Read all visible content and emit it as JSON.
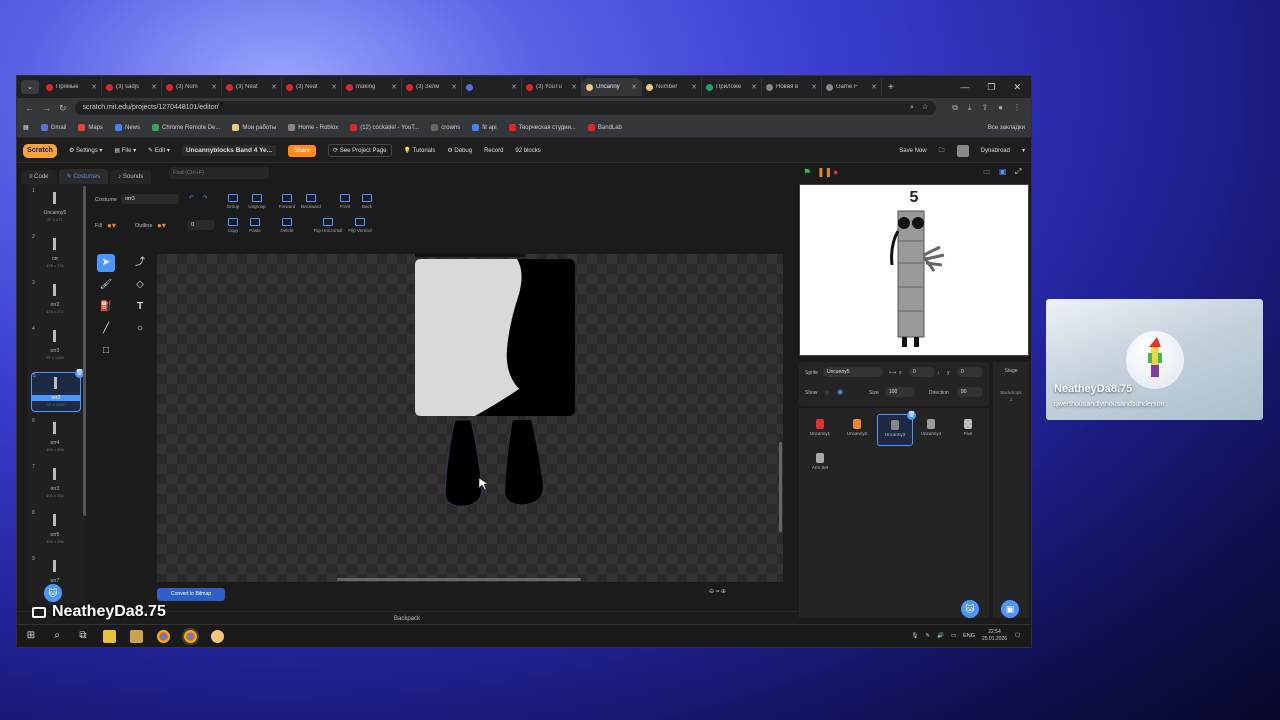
{
  "browser": {
    "tabs": [
      {
        "title": "Прямые",
        "color": "#e0242b"
      },
      {
        "title": "(3) sadjs",
        "color": "#e0242b"
      },
      {
        "title": "(3) Num",
        "color": "#e0242b"
      },
      {
        "title": "(3) Neat",
        "color": "#e0242b"
      },
      {
        "title": "(3) Neat",
        "color": "#e0242b"
      },
      {
        "title": "making",
        "color": "#e0242b"
      },
      {
        "title": "(3) Зелм",
        "color": "#e0242b"
      },
      {
        "title": "",
        "color": "#5b6ee1"
      },
      {
        "title": "(3) YouTu",
        "color": "#e0242b"
      },
      {
        "title": "Uncanny",
        "color": "#f3c77b"
      },
      {
        "title": "Number",
        "color": "#f3c77b"
      },
      {
        "title": "Приложе",
        "color": "#1fa463"
      },
      {
        "title": "Новая в",
        "color": "#888888"
      },
      {
        "title": "Game F",
        "color": "#888888"
      }
    ],
    "active_tab": 9,
    "new_tab": "+",
    "url": "scratch.mit.edu/projects/1270448101/editor/",
    "bookmarks": [
      "Gmail",
      "Maps",
      "News",
      "Chrome Remote De...",
      "Мои работы",
      "Home - Roblox",
      "(12) cockatiel - YouT...",
      "crowns",
      "fit api",
      "Творческая студия...",
      "BandLab"
    ],
    "all_bookmarks": "Все закладки"
  },
  "scratch": {
    "logo": "Scratch",
    "menu": [
      "Settings",
      "File",
      "Edit"
    ],
    "project_title": "Uncannyblocks Band 4 Ye...",
    "share": "Share",
    "see_project_page": "See Project Page",
    "tutorials": "Tutorials",
    "debug": "Debug",
    "record": "Record",
    "blocks": "92 blocks",
    "save_now": "Save Now",
    "username": "Dynabroad",
    "tabs": [
      "Code",
      "Costumes",
      "Sounds"
    ],
    "find_placeholder": "Find (Ctrl+F)",
    "costumes": [
      {
        "n": "1",
        "name": "Uncanny5",
        "dim": "97 x 277"
      },
      {
        "n": "2",
        "name": "orr",
        "dim": "126 x 276"
      },
      {
        "n": "3",
        "name": "orr2",
        "dim": "126 x 277"
      },
      {
        "n": "4",
        "name": "orr3",
        "dim": "97 x 1289"
      },
      {
        "n": "5",
        "name": "orr3",
        "dim": "97 x 1297"
      },
      {
        "n": "6",
        "name": "orr4",
        "dim": "100 x 200"
      },
      {
        "n": "7",
        "name": "orr3",
        "dim": "100 x 200"
      },
      {
        "n": "8",
        "name": "orr5",
        "dim": "100 x 200"
      },
      {
        "n": "9",
        "name": "orr7",
        "dim": ""
      }
    ],
    "selected_costume": 4,
    "costume_label": "Costume",
    "costume_name": "orr3",
    "fill_label": "Fill",
    "outline_label": "Outline",
    "outline_value": "0",
    "toolbar_top": [
      "Group",
      "Ungroup",
      "Forward",
      "Backward",
      "Front",
      "Back"
    ],
    "toolbar_bottom": [
      "Copy",
      "Paste",
      "Delete",
      "Flip Horizontal",
      "Flip Vertical"
    ],
    "convert": "Convert to Bitmap",
    "zoom": "⊖  =  ⊕",
    "backpack": "Backpack",
    "stage_number": "5",
    "sprite_label": "Sprite",
    "sprite_name": "Uncanny5",
    "x_label": "x",
    "x_value": "0",
    "y_label": "y",
    "y_value": "0",
    "show_label": "Show",
    "size_label": "Size",
    "size_value": "100",
    "direction_label": "Direction",
    "direction_value": "90",
    "stage_label": "Stage",
    "backdrops_label": "Backdrops",
    "backdrops_count": "1",
    "sprites": [
      {
        "name": "Uncanny1",
        "color": "#d33"
      },
      {
        "name": "Uncanny2",
        "color": "#e88a2a"
      },
      {
        "name": "Uncanny3",
        "color": "#888"
      },
      {
        "name": "Uncanny4",
        "color": "#999"
      },
      {
        "name": "Five",
        "color": "#bbb"
      },
      {
        "name": "Arm Set",
        "color": "#aaa"
      }
    ],
    "selected_sprite": 2
  },
  "taskbar": {
    "lang": "ENG",
    "time": "22:54",
    "date": "25.01.2026"
  },
  "overlay": {
    "streamer": "NeatheyDa8.75",
    "card_name": "NeatheyDa8.75",
    "card_sub": "qwerthousandlythousandsunderson"
  }
}
